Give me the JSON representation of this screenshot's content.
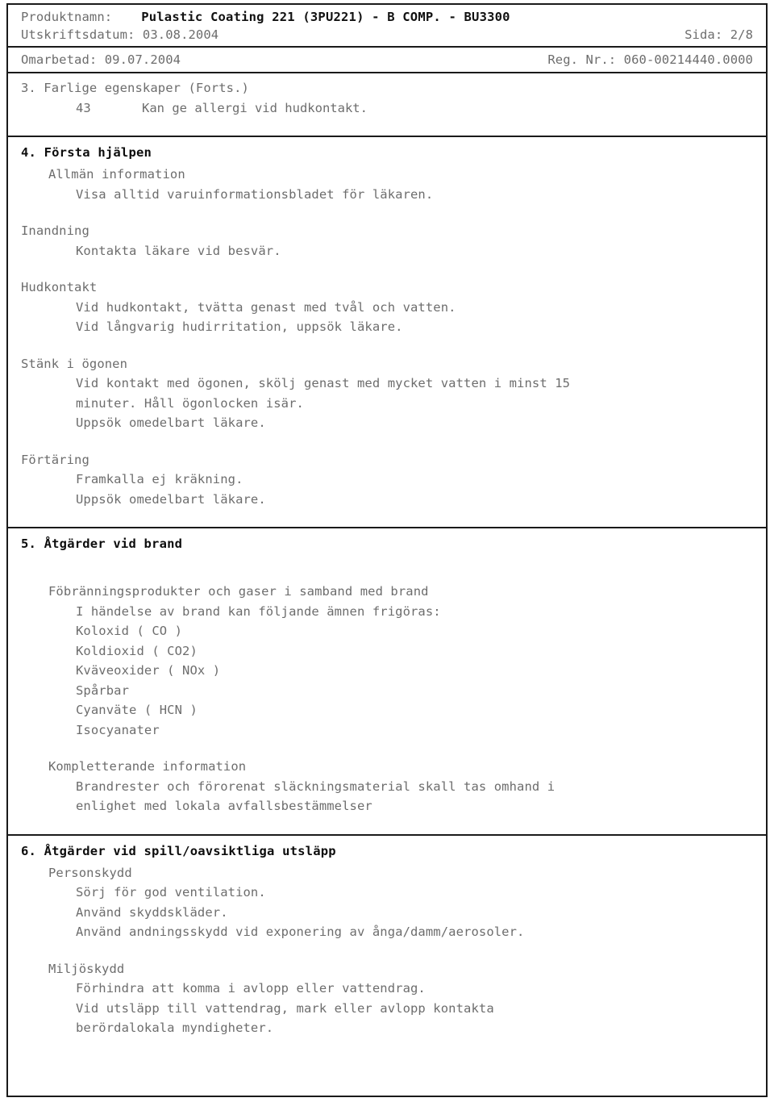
{
  "header": {
    "product_label": "Produktnamn:",
    "product_name": "Pulastic Coating 221 (3PU221) - B COMP. - BU3300",
    "print_date_label": "Utskriftsdatum: 03.08.2004",
    "page_label": "Sida: 2/8",
    "revised_label": "Omarbetad: 09.07.2004",
    "reg_label": "Reg. Nr.: 060-00214440.0000"
  },
  "section3": {
    "title": "3. Farlige egenskaper (Forts.)",
    "risk_code": "43",
    "risk_text": "Kan ge allergi vid hudkontakt."
  },
  "section4": {
    "title": "4. Första hjälpen",
    "general_heading": "Allmän information",
    "general_line": "Visa alltid varuinformationsbladet för läkaren.",
    "inhalation_heading": "Inandning",
    "inhalation_line": "Kontakta läkare vid besvär.",
    "skin_heading": "Hudkontakt",
    "skin_line1": "Vid hudkontakt, tvätta genast med tvål och vatten.",
    "skin_line2": "Vid långvarig hudirritation, uppsök läkare.",
    "eyes_heading": "Stänk i ögonen",
    "eyes_line1": "Vid kontakt med ögonen, skölj genast med mycket vatten i minst 15",
    "eyes_line2": "minuter. Håll ögonlocken isär.",
    "eyes_line3": "Uppsök omedelbart läkare.",
    "ingestion_heading": "Förtäring",
    "ingestion_line1": "Framkalla ej kräkning.",
    "ingestion_line2": "Uppsök omedelbart läkare."
  },
  "section5": {
    "title": "5. Åtgärder vid brand",
    "combustion_heading": "Föbränningsprodukter och gaser i samband med brand",
    "combustion_intro": "I händelse av brand kan följande ämnen frigöras:",
    "substances": [
      "Koloxid ( CO )",
      "Koldioxid ( CO2)",
      "Kväveoxider ( NOx )",
      "Spårbar",
      "Cyanväte ( HCN )",
      "Isocyanater"
    ],
    "additional_heading": "Kompletterande information",
    "additional_line1": "Brandrester och förorenat släckningsmaterial skall tas omhand i",
    "additional_line2": "enlighet med lokala avfallsbestämmelser"
  },
  "section6": {
    "title": "6. Åtgärder vid spill/oavsiktliga utsläpp",
    "personal_heading": "Personskydd",
    "personal_line1": "Sörj för god ventilation.",
    "personal_line2": "Använd skyddskläder.",
    "personal_line3": "Använd andningsskydd vid exponering av ånga/damm/aerosoler.",
    "environment_heading": "Miljöskydd",
    "environment_line1": "Förhindra att komma i avlopp eller vattendrag.",
    "environment_line2": "Vid utsläpp till vattendrag, mark eller avlopp kontakta",
    "environment_line3": "berördalokala myndigheter."
  }
}
